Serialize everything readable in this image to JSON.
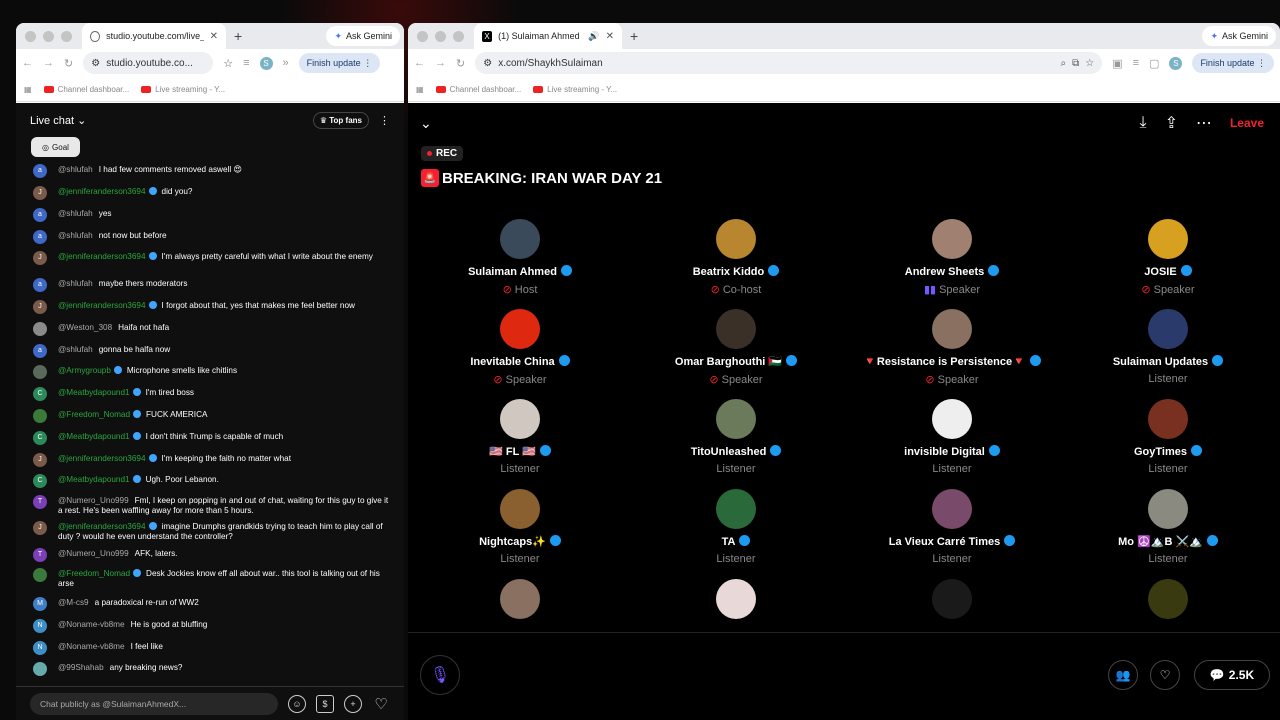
{
  "colors": {
    "x_red": "#f4212e",
    "verified_blue": "#1d9bf0",
    "yt_green": "#2ba640",
    "speaker_purple": "#7856ff"
  },
  "left_window": {
    "tab_title": "studio.youtube.com/live_chat",
    "address": "studio.youtube.co...",
    "ask_gemini": "Ask Gemini",
    "finish_update": "Finish update",
    "profile_letter": "S",
    "bookmarks": [
      "Channel dashboar...",
      "Live streaming - Y..."
    ],
    "chat": {
      "header": "Live chat",
      "top_fans": "Top fans",
      "goal": "Goal",
      "input_placeholder": "Chat publicly as @SulaimanAhmedX...",
      "messages": [
        {
          "author": "@shlufah",
          "text": "I had few comments removed aswell 😍",
          "init": "a",
          "color": "#3f68c7"
        },
        {
          "author": "@jenniferanderson3694",
          "text": "did you?",
          "init": "J",
          "color": "#7a5b4a",
          "member": true
        },
        {
          "author": "@shlufah",
          "text": "yes",
          "init": "a",
          "color": "#3f68c7"
        },
        {
          "author": "@shlufah",
          "text": "not now but before",
          "init": "a",
          "color": "#3f68c7"
        },
        {
          "author": "@jenniferanderson3694",
          "text": "I'm always pretty careful with what I write about the enemy",
          "init": "J",
          "color": "#7a5b4a",
          "member": true
        },
        {
          "author": "@shlufah",
          "text": "maybe thers moderators",
          "init": "a",
          "color": "#3f68c7"
        },
        {
          "author": "@jenniferanderson3694",
          "text": "I forgot about that, yes that makes me feel better now",
          "init": "J",
          "color": "#7a5b4a",
          "member": true
        },
        {
          "author": "@Weston_308",
          "text": "Haifa not hafa",
          "init": "",
          "color": "#8a8a8a"
        },
        {
          "author": "@shlufah",
          "text": "gonna be halfa now",
          "init": "a",
          "color": "#3f68c7"
        },
        {
          "author": "@Armygroupb",
          "text": "Microphone smells like chitlins",
          "init": "",
          "color": "#5a6a5a",
          "member": true
        },
        {
          "author": "@Meatbydapound1",
          "text": "I'm tired boss",
          "init": "C",
          "color": "#2b8a5a",
          "member": true
        },
        {
          "author": "@Freedom_Nomad",
          "text": "FUCK AMERICA",
          "init": "",
          "color": "#3a7a3a",
          "member": true
        },
        {
          "author": "@Meatbydapound1",
          "text": "I don't think Trump is capable of much",
          "init": "C",
          "color": "#2b8a5a",
          "member": true
        },
        {
          "author": "@jenniferanderson3694",
          "text": "I'm keeping the faith no matter what",
          "init": "J",
          "color": "#7a5b4a",
          "member": true
        },
        {
          "author": "@Meatbydapound1",
          "text": "Ugh. Poor Lebanon.",
          "init": "C",
          "color": "#2b8a5a",
          "member": true
        },
        {
          "author": "@Numero_Uno999",
          "text": "Fml, I keep on popping in and out of chat, waiting for this guy to give it a rest. He's been waffling away for more than 5 hours.",
          "init": "T",
          "color": "#7b3fb8"
        },
        {
          "author": "@jenniferanderson3694",
          "text": "imagine Drumphs grandkids trying to teach him to play call of duty ? would he even understand the controller?",
          "init": "J",
          "color": "#7a5b4a",
          "member": true
        },
        {
          "author": "@Numero_Uno999",
          "text": "AFK, laters.",
          "init": "T",
          "color": "#7b3fb8"
        },
        {
          "author": "@Freedom_Nomad",
          "text": "Desk Jockies know eff all about war.. this tool is talking out of his arse",
          "init": "",
          "color": "#3a7a3a",
          "member": true
        },
        {
          "author": "@M-cs9",
          "text": "a paradoxical re-run of WW2",
          "init": "M",
          "color": "#3f7fc7"
        },
        {
          "author": "@Noname-vb8me",
          "text": "He is good at bluffing",
          "init": "N",
          "color": "#3f8fc7"
        },
        {
          "author": "@Noname-vb8me",
          "text": "I feel like",
          "init": "N",
          "color": "#3f8fc7"
        },
        {
          "author": "@99Shahab",
          "text": "any breaking news?",
          "init": "",
          "color": "#6aa"
        }
      ]
    }
  },
  "right_window": {
    "tab_title": "(1) Sulaiman Ahmed (@Sh",
    "address": "x.com/ShaykhSulaiman",
    "ask_gemini": "Ask Gemini",
    "finish_update": "Finish update",
    "profile_letter": "S",
    "bookmarks": [
      "Channel dashboar...",
      "Live streaming - Y..."
    ],
    "space": {
      "leave": "Leave",
      "rec": "REC",
      "title": "BREAKING: IRAN WAR DAY 21",
      "listener_count": "2.5K",
      "participants": [
        {
          "name": "Sulaiman Ahmed",
          "role": "Host",
          "role_type": "mic",
          "pic": "#3a4a5a"
        },
        {
          "name": "Beatrix Kiddo",
          "role": "Co-host",
          "role_type": "mic",
          "pic": "#b8862e"
        },
        {
          "name": "Andrew Sheets",
          "role": "Speaker",
          "role_type": "speaking",
          "pic": "#a08070"
        },
        {
          "name": "JOSIE",
          "role": "Speaker",
          "role_type": "mic",
          "pic": "#d8a020"
        },
        {
          "name": "Inevitable China",
          "role": "Speaker",
          "role_type": "mic",
          "pic": "#de2910"
        },
        {
          "name": "Omar Barghouthi 🇵🇸",
          "role": "Speaker",
          "role_type": "mic",
          "pic": "#3a3028"
        },
        {
          "name": "🔻Resistance is Persistence🔻",
          "role": "Speaker",
          "role_type": "mic",
          "pic": "#8a7060"
        },
        {
          "name": "Sulaiman Updates",
          "role": "Listener",
          "role_type": "none",
          "pic": "#2a3a6a"
        },
        {
          "name": "🇺🇸 FL 🇺🇸",
          "role": "Listener",
          "role_type": "none",
          "pic": "#d0c8c0"
        },
        {
          "name": "TitoUnleashed",
          "role": "Listener",
          "role_type": "none",
          "pic": "#6a7a5a"
        },
        {
          "name": "invisible Digital",
          "role": "Listener",
          "role_type": "none",
          "pic": "#eeeeee"
        },
        {
          "name": "GoyTimes",
          "role": "Listener",
          "role_type": "none",
          "pic": "#7a3020"
        },
        {
          "name": "Nightcaps✨",
          "role": "Listener",
          "role_type": "none",
          "pic": "#8a6030"
        },
        {
          "name": "TA",
          "role": "Listener",
          "role_type": "none",
          "pic": "#2a6a3a"
        },
        {
          "name": "La Vieux Carré Times",
          "role": "Listener",
          "role_type": "none",
          "pic": "#7a4a6a"
        },
        {
          "name": "Mo ☮️🏔️B ⚔️🏔️",
          "role": "Listener",
          "role_type": "none",
          "pic": "#8a8a80"
        },
        {
          "name": "",
          "role": "",
          "role_type": "none",
          "pic": "#8a7060"
        },
        {
          "name": "",
          "role": "",
          "role_type": "none",
          "pic": "#e8d8d8"
        },
        {
          "name": "",
          "role": "",
          "role_type": "none",
          "pic": "#1a1a1a"
        },
        {
          "name": "",
          "role": "",
          "role_type": "none",
          "pic": "#3a3a10"
        }
      ]
    }
  }
}
